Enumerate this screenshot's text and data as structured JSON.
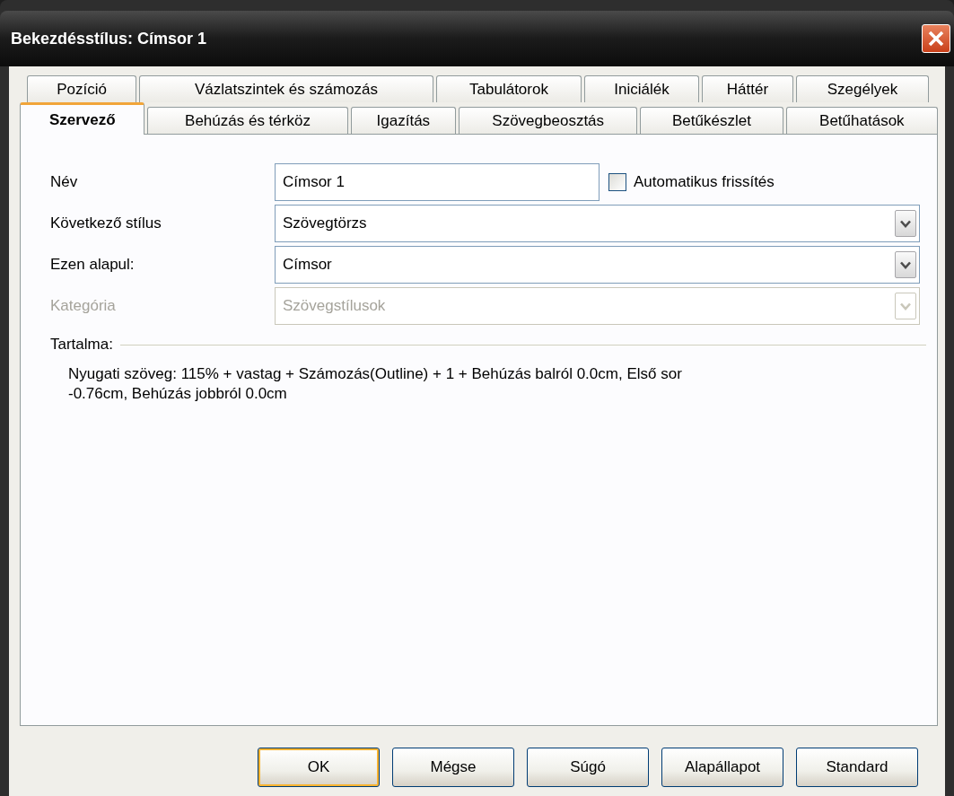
{
  "window": {
    "title": "Bekezdésstílus: Címsor 1"
  },
  "tab_rows": [
    [
      {
        "label": "Pozíció",
        "selected": false
      },
      {
        "label": "Vázlatszintek és számozás",
        "selected": false
      },
      {
        "label": "Tabulátorok",
        "selected": false
      },
      {
        "label": "Iniciálék",
        "selected": false
      },
      {
        "label": "Háttér",
        "selected": false
      },
      {
        "label": "Szegélyek",
        "selected": false
      }
    ],
    [
      {
        "label": "Szervező",
        "selected": true
      },
      {
        "label": "Behúzás és térköz",
        "selected": false
      },
      {
        "label": "Igazítás",
        "selected": false
      },
      {
        "label": "Szövegbeosztás",
        "selected": false
      },
      {
        "label": "Betűkészlet",
        "selected": false
      },
      {
        "label": "Betűhatások",
        "selected": false
      }
    ]
  ],
  "fields": [
    {
      "kind": "text",
      "label": "Név",
      "value": "Címsor 1",
      "disabled": false,
      "checkbox": {
        "label": "Automatikus frissítés",
        "checked": false
      }
    },
    {
      "kind": "dropdown",
      "label": "Következő stílus",
      "value": "Szövegtörzs",
      "disabled": false
    },
    {
      "kind": "dropdown",
      "label": "Ezen alapul:",
      "value": "Címsor",
      "disabled": false
    },
    {
      "kind": "dropdown",
      "label": "Kategória",
      "value": "Szövegstílusok",
      "disabled": true
    }
  ],
  "contents": {
    "heading": "Tartalma:",
    "text": "Nyugati szöveg: 115% + vastag + Számozás(Outline) + 1 + Behúzás balról 0.0cm, Első sor -0.76cm, Behúzás jobbról 0.0cm"
  },
  "buttons": [
    {
      "label": "OK",
      "default": true
    },
    {
      "label": "Mégse",
      "default": false
    },
    {
      "label": "Súgó",
      "default": false
    },
    {
      "label": "Alapállapot",
      "default": false
    },
    {
      "label": "Standard",
      "default": false
    }
  ]
}
